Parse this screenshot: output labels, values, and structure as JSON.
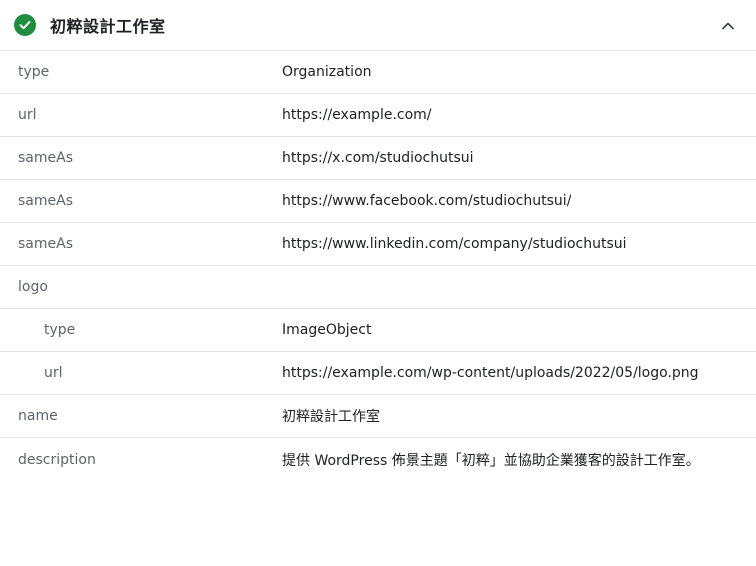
{
  "header": {
    "title": "初粹設計工作室",
    "status_icon": "check-circle-icon",
    "status_color": "#1e8e3e",
    "toggle_icon": "chevron-up-icon"
  },
  "rows": [
    {
      "key": "type",
      "value": "Organization",
      "nested": false
    },
    {
      "key": "url",
      "value": "https://example.com/",
      "nested": false
    },
    {
      "key": "sameAs",
      "value": "https://x.com/studiochutsui",
      "nested": false
    },
    {
      "key": "sameAs",
      "value": "https://www.facebook.com/studiochutsui/",
      "nested": false
    },
    {
      "key": "sameAs",
      "value": "https://www.linkedin.com/company/studiochutsui",
      "nested": false
    },
    {
      "key": "logo",
      "value": "",
      "nested": false
    },
    {
      "key": "type",
      "value": "ImageObject",
      "nested": true
    },
    {
      "key": "url",
      "value": "https://example.com/wp-content/uploads/2022/05/logo.png",
      "nested": true
    },
    {
      "key": "name",
      "value": "初粹設計工作室",
      "nested": false
    },
    {
      "key": "description",
      "value": "提供 WordPress 佈景主題「初粹」並協助企業獲客的設計工作室。",
      "nested": false
    }
  ]
}
